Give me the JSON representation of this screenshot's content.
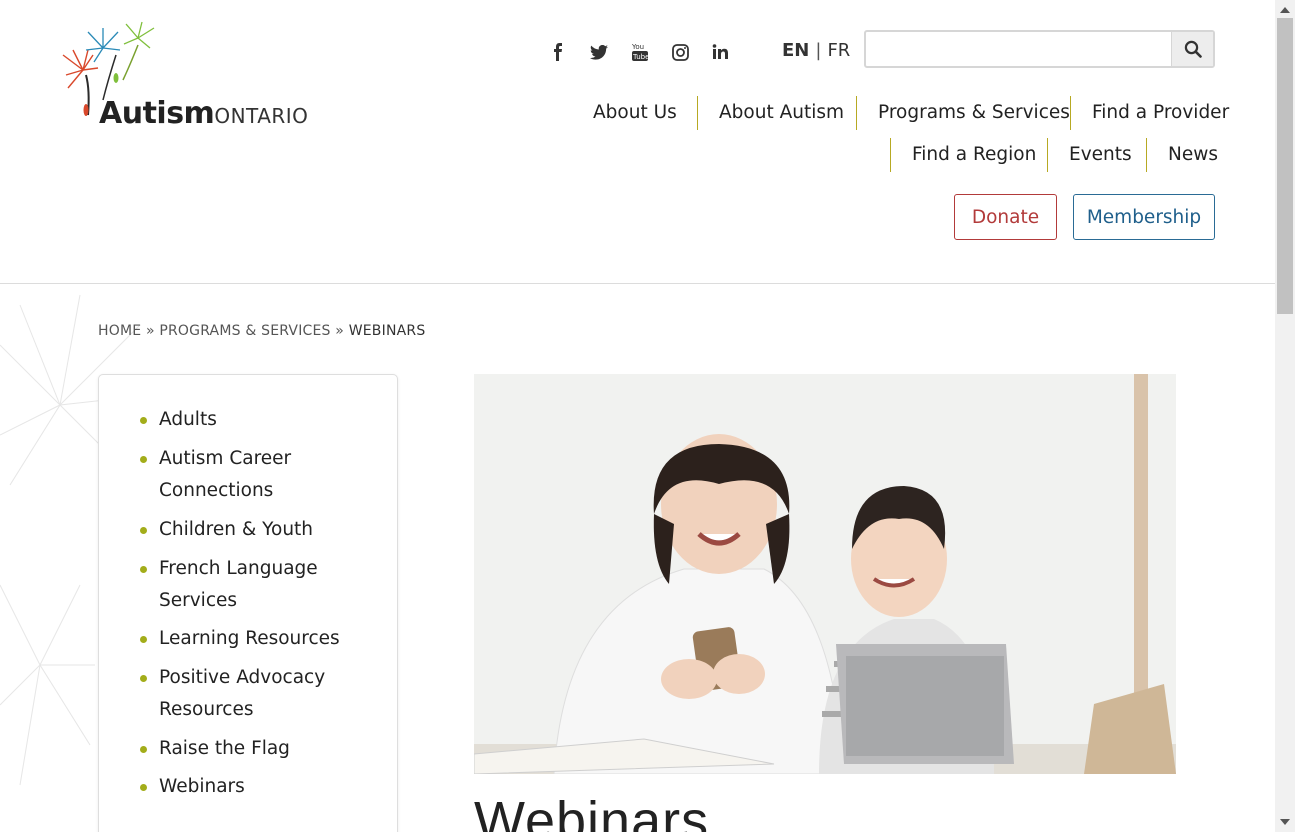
{
  "brand": {
    "name": "Autism",
    "suffix": "ONTARIO"
  },
  "social": [
    {
      "icon": "facebook-icon"
    },
    {
      "icon": "twitter-icon"
    },
    {
      "icon": "youtube-icon"
    },
    {
      "icon": "instagram-icon"
    },
    {
      "icon": "linkedin-icon"
    }
  ],
  "lang": {
    "current": "EN",
    "separator": "|",
    "alt": "FR"
  },
  "search": {
    "value": "",
    "placeholder": ""
  },
  "nav": {
    "row1": [
      "About Us",
      "About Autism",
      "Programs & Services",
      "Find a Provider"
    ],
    "row2": [
      "Find a Region",
      "Events",
      "News"
    ]
  },
  "cta": {
    "donate": "Donate",
    "membership": "Membership"
  },
  "breadcrumb": {
    "home": "HOME",
    "sep": "»",
    "section": "PROGRAMS & SERVICES",
    "current": "WEBINARS"
  },
  "sidebar": {
    "items": [
      "Adults",
      "Autism Career Connections",
      "Children & Youth",
      "French Language Services",
      "Learning Resources",
      "Positive Advocacy Resources",
      "Raise the Flag",
      "Webinars"
    ]
  },
  "page": {
    "title": "Webinars"
  },
  "colors": {
    "accent_gold": "#b7a923",
    "bullet": "#a3ad1a",
    "donate": "#b23a3a",
    "membership": "#1f5f8b"
  }
}
